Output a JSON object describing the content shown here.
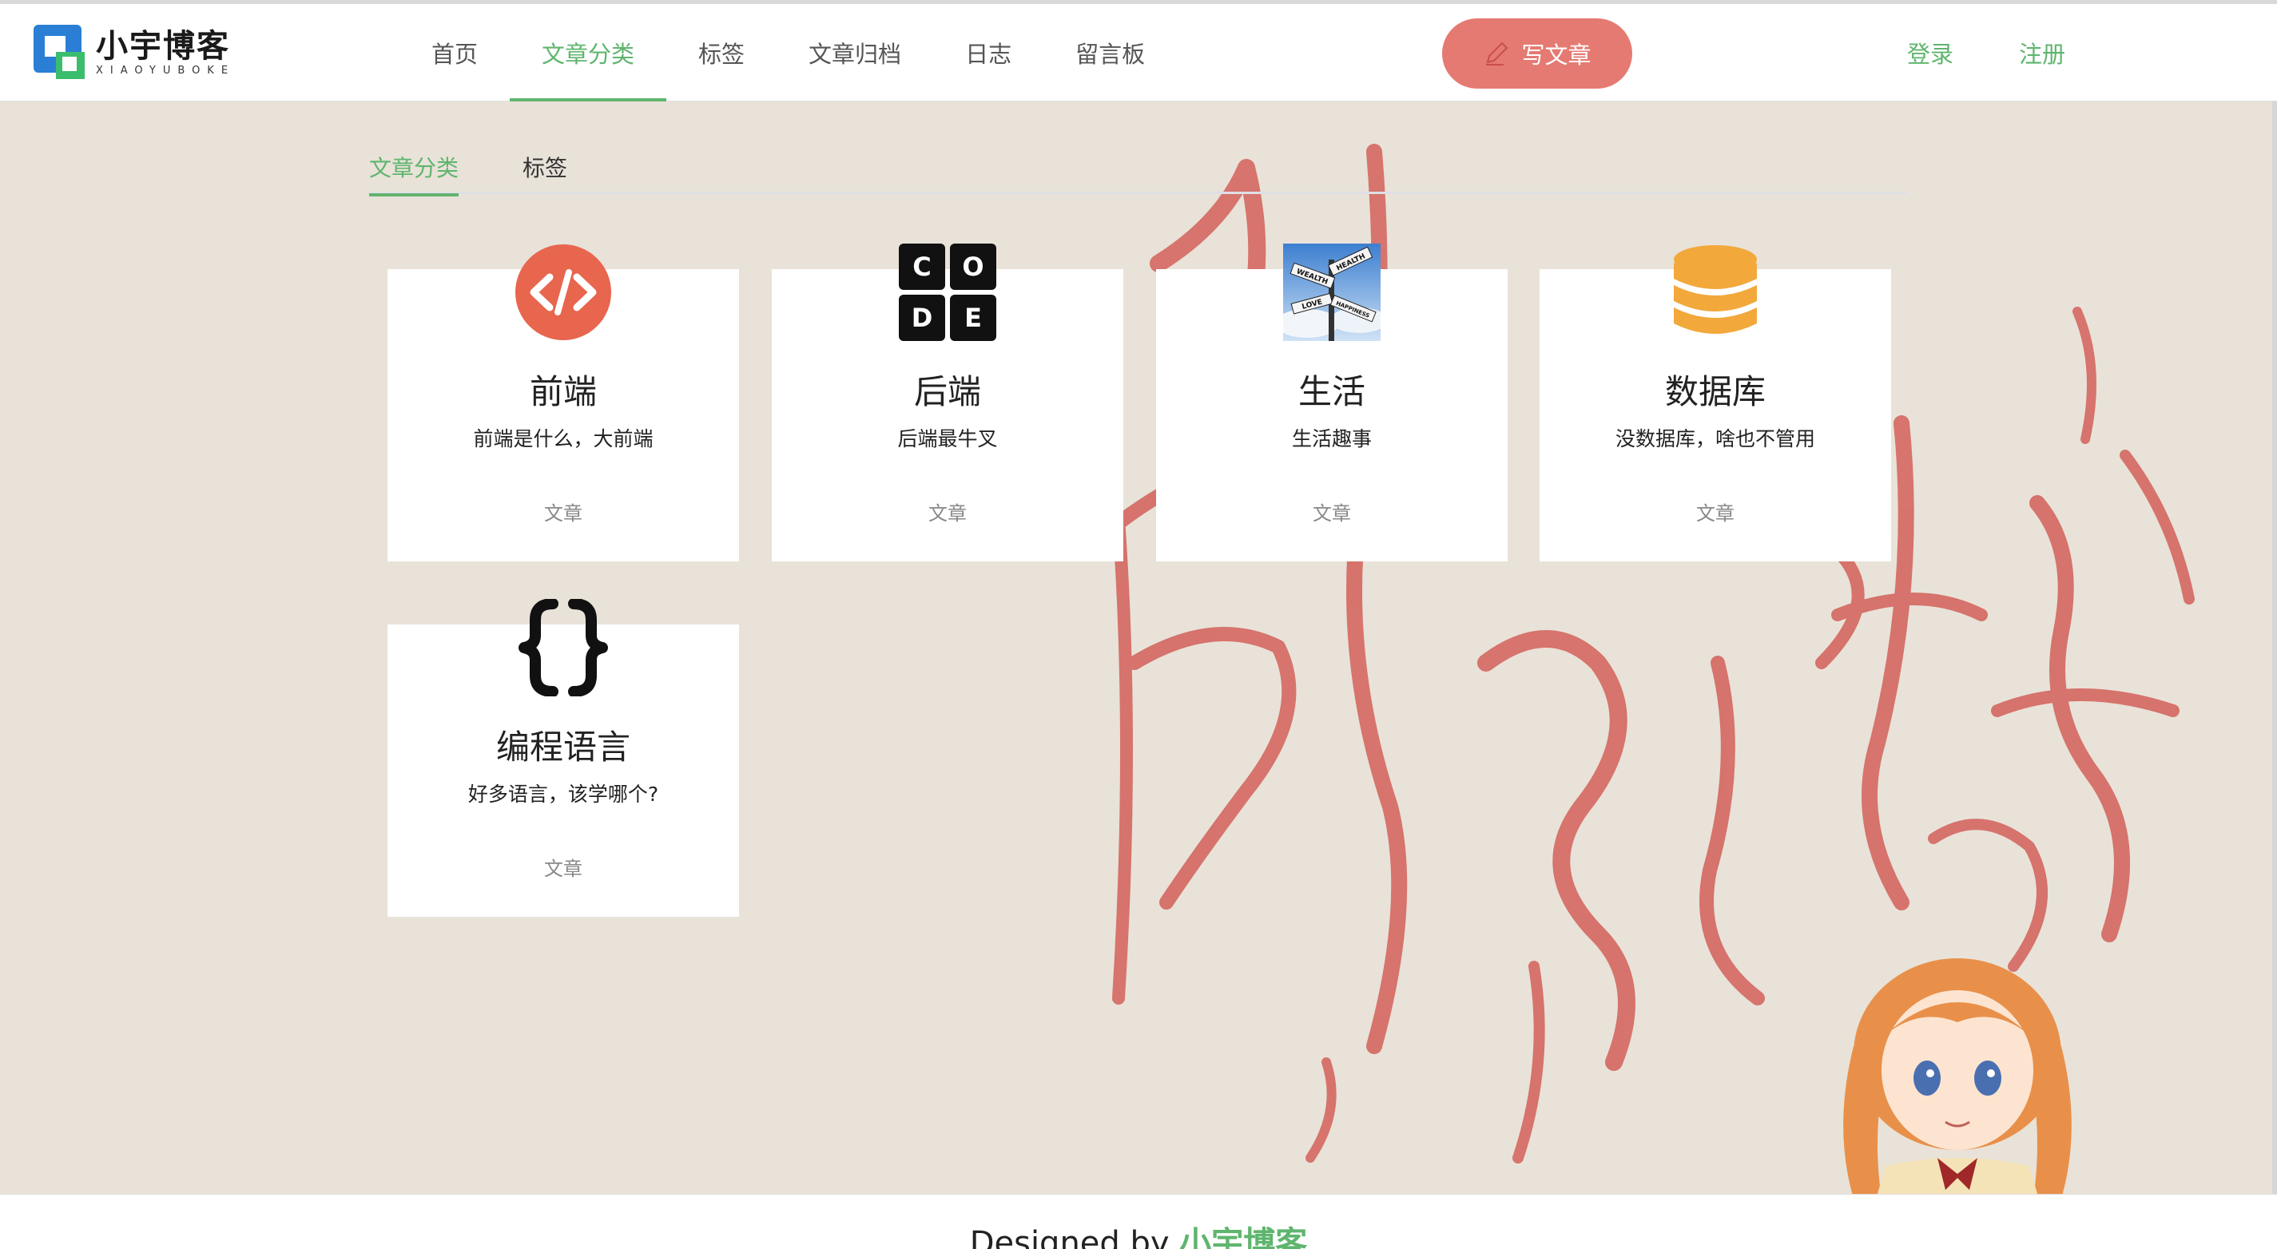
{
  "brand": {
    "name_cn": "小宇博客",
    "name_en": "XIAOYUBOKE"
  },
  "nav": {
    "items": [
      {
        "label": "首页"
      },
      {
        "label": "文章分类",
        "active": true
      },
      {
        "label": "标签"
      },
      {
        "label": "文章归档"
      },
      {
        "label": "日志"
      },
      {
        "label": "留言板"
      }
    ],
    "write_button": "写文章",
    "login": "登录",
    "register": "注册"
  },
  "subtabs": {
    "categories": "文章分类",
    "tags": "标签"
  },
  "categories": [
    {
      "title": "前端",
      "desc": "前端是什么，大前端",
      "foot": "文章",
      "icon": "code-brackets-icon"
    },
    {
      "title": "后端",
      "desc": "后端最牛叉",
      "foot": "文章",
      "icon": "code-blocks-icon"
    },
    {
      "title": "生活",
      "desc": "生活趣事",
      "foot": "文章",
      "icon": "signpost-icon"
    },
    {
      "title": "数据库",
      "desc": "没数据库，啥也不管用",
      "foot": "文章",
      "icon": "database-icon"
    },
    {
      "title": "编程语言",
      "desc": "好多语言，该学哪个?",
      "foot": "文章",
      "icon": "curly-braces-icon"
    }
  ],
  "code_icon_letters": [
    "C",
    "O",
    "D",
    "E"
  ],
  "sign_words": [
    "WEALTH",
    "HEALTH",
    "LOVE",
    "HAPPINESS"
  ],
  "footer": {
    "prefix": "Designed by ",
    "brand": "小宇博客"
  },
  "colors": {
    "accent": "#5fb56e",
    "write_button": "#e57a72",
    "background": "#e9e2d8"
  }
}
